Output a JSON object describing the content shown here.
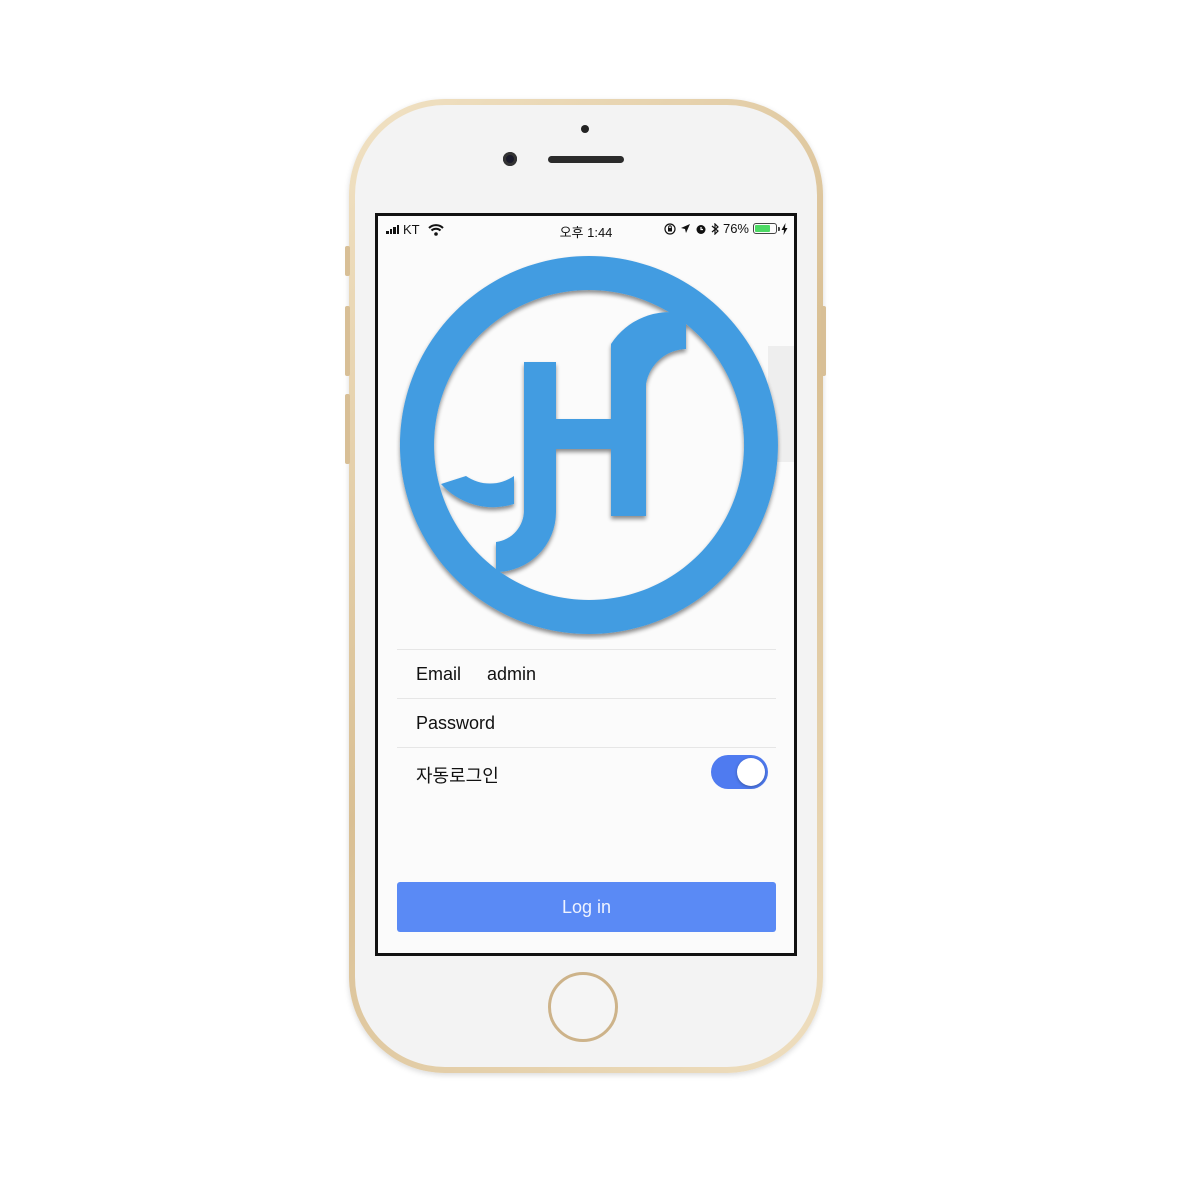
{
  "status_bar": {
    "carrier": "KT",
    "time": "오후 1:44",
    "battery_percent": "76%",
    "battery_level": 0.76,
    "icons": [
      "signal-bars-icon",
      "wifi-icon",
      "rotation-lock-icon",
      "location-arrow-icon",
      "alarm-icon",
      "bluetooth-icon",
      "battery-icon",
      "charging-bolt-icon"
    ]
  },
  "logo": {
    "icon": "jh-circle-logo",
    "color": "#439ce1"
  },
  "form": {
    "email": {
      "label": "Email",
      "value": "admin"
    },
    "password": {
      "label": "Password",
      "value": ""
    },
    "auto_login": {
      "label": "자동로그인",
      "enabled": true
    }
  },
  "login_button": {
    "label": "Log in",
    "color": "#5a8af5"
  },
  "toggle_color": "#4f7bf0"
}
